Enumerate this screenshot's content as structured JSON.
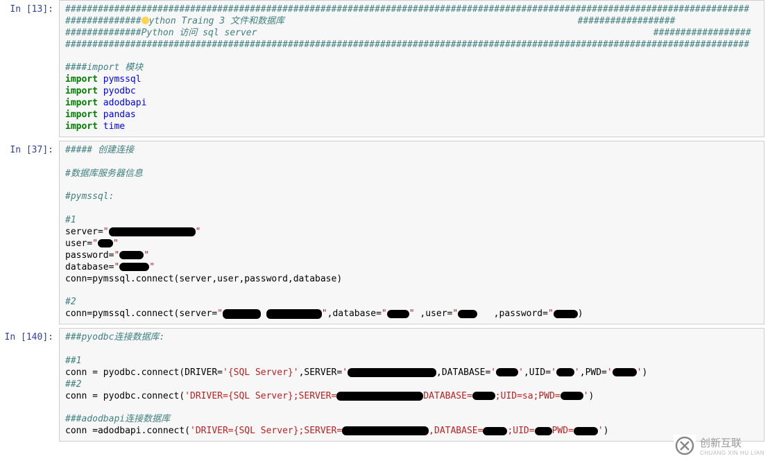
{
  "cells": {
    "c1": {
      "prompt": "In [13]:"
    },
    "c2": {
      "prompt": "In [37]:"
    },
    "c3": {
      "prompt": "In [140]:"
    }
  },
  "c1_lines": {
    "l1": "##############################################################################################################################",
    "l2a": "##############",
    "l2b": "ython Traing 3 文件和数据库                                                      ##################",
    "l3": "##############Python 访问 sql server                                                                         ##################",
    "l4": "##############################################################################################################################",
    "l5": "####import 模块",
    "imp": "import",
    "m1": "pymssql",
    "m2": "pyodbc",
    "m3": "adodbapi",
    "m4": "pandas",
    "m5": "time"
  },
  "c2_lines": {
    "l1": "##### 创建连接",
    "l2": "#数据库服务器信息",
    "l3": "#pymssql:",
    "l4": "#1",
    "svr": "server=",
    "usr": "user=",
    "pwd": "password=",
    "db": "database=",
    "conn1": "conn=pymssql.connect(server,user,password,database)",
    "l5": "#2",
    "conn2a": "conn=pymssql.connect(server=",
    "qd": "\"",
    "dbarg": ",database=",
    "userarg": " ,user=",
    "pwdarg": "   ,password=",
    "end": ")"
  },
  "c3_lines": {
    "l1": "###pyodbc连接数据库:",
    "l2": "##1",
    "conn1a": "conn = pyodbc.connect(DRIVER=",
    "drv": "'{SQL Server}'",
    "srvk": ",SERVER=",
    "q": "'",
    "dbk": ",DATABASE=",
    "uidk": ",UID=",
    "pwdk": ",PWD=",
    "end": ")",
    "l3": "##2",
    "conn2a": "conn = pyodbc.connect(",
    "s2": "'DRIVER={SQL Server};SERVER=",
    "s2b": "DATABASE=",
    "s2c": ";UID=sa;PWD=",
    "l4": "###adodbapi连接数据库",
    "conn3a": "conn =adodbapi.connect(",
    "s3": "'DRIVER={SQL Server};SERVER=",
    "s3b": ",DATABASE=",
    "s3c": ";UID=",
    "s3d": "PWD="
  },
  "watermark": {
    "brand": "创新互联",
    "sub": "CHUANG XIN HU LIAN"
  }
}
